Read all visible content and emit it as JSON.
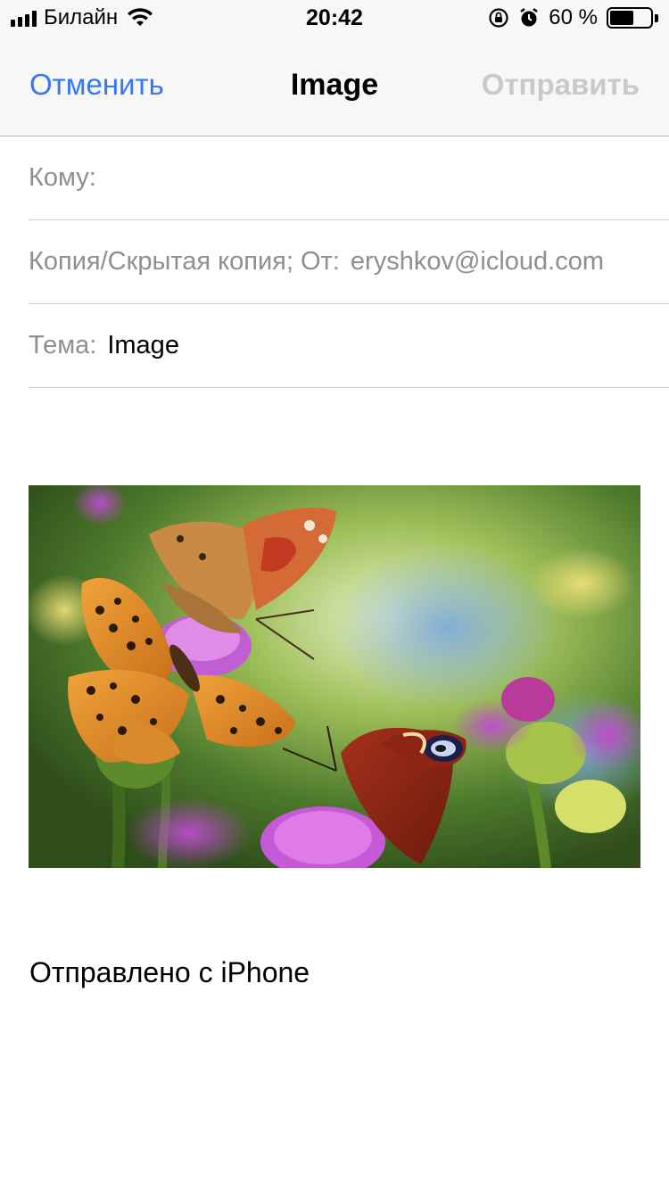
{
  "status_bar": {
    "carrier": "Билайн",
    "time": "20:42",
    "battery_percent_text": "60 %",
    "battery_level": 0.6,
    "icons": [
      "signal-icon",
      "wifi-icon",
      "rotation-lock-icon",
      "alarm-icon",
      "battery-icon"
    ]
  },
  "nav": {
    "cancel_label": "Отменить",
    "title": "Image",
    "send_label": "Отправить"
  },
  "compose": {
    "to_label": "Кому:",
    "to_value": "",
    "cc_from_label": "Копия/Скрытая копия; От:",
    "from_value": "eryshkov@icloud.com",
    "subject_label": "Тема:",
    "subject_value": "Image"
  },
  "body": {
    "attachment_icon": "butterflies-photo",
    "signature": "Отправлено с iPhone"
  },
  "colors": {
    "accent": "#3478f6",
    "disabled": "#c9c9c9",
    "secondary_text": "#8e8e93"
  }
}
